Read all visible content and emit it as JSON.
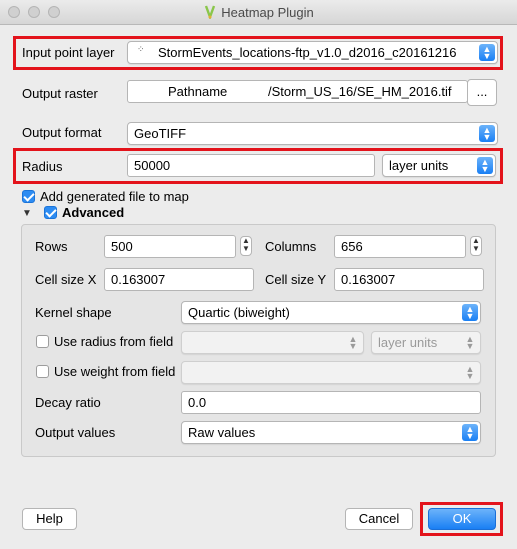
{
  "window": {
    "title": "Heatmap Plugin"
  },
  "input_layer": {
    "label": "Input point layer",
    "value": "StormEvents_locations-ftp_v1.0_d2016_c20161216"
  },
  "output_raster": {
    "label": "Output raster",
    "value_prefix": "Pathname",
    "value_suffix": "/Storm_US_16/SE_HM_2016.tif",
    "browse": "..."
  },
  "output_format": {
    "label": "Output format",
    "value": "GeoTIFF"
  },
  "radius": {
    "label": "Radius",
    "value": "50000",
    "units": "layer units"
  },
  "add_to_map": {
    "label": "Add generated file to map",
    "checked": true
  },
  "advanced": {
    "label": "Advanced",
    "rows_label": "Rows",
    "rows": "500",
    "columns_label": "Columns",
    "columns": "656",
    "cell_x_label": "Cell size X",
    "cell_x": "0.163007",
    "cell_y_label": "Cell size Y",
    "cell_y": "0.163007",
    "kernel_label": "Kernel shape",
    "kernel": "Quartic (biweight)",
    "radius_field_label": "Use radius from field",
    "radius_field_units": "layer units",
    "weight_field_label": "Use weight from field",
    "decay_label": "Decay ratio",
    "decay": "0.0",
    "output_values_label": "Output values",
    "output_values": "Raw values"
  },
  "buttons": {
    "help": "Help",
    "cancel": "Cancel",
    "ok": "OK"
  },
  "colors": {
    "accent": "#1a7ff4",
    "highlight": "#e3131b"
  }
}
